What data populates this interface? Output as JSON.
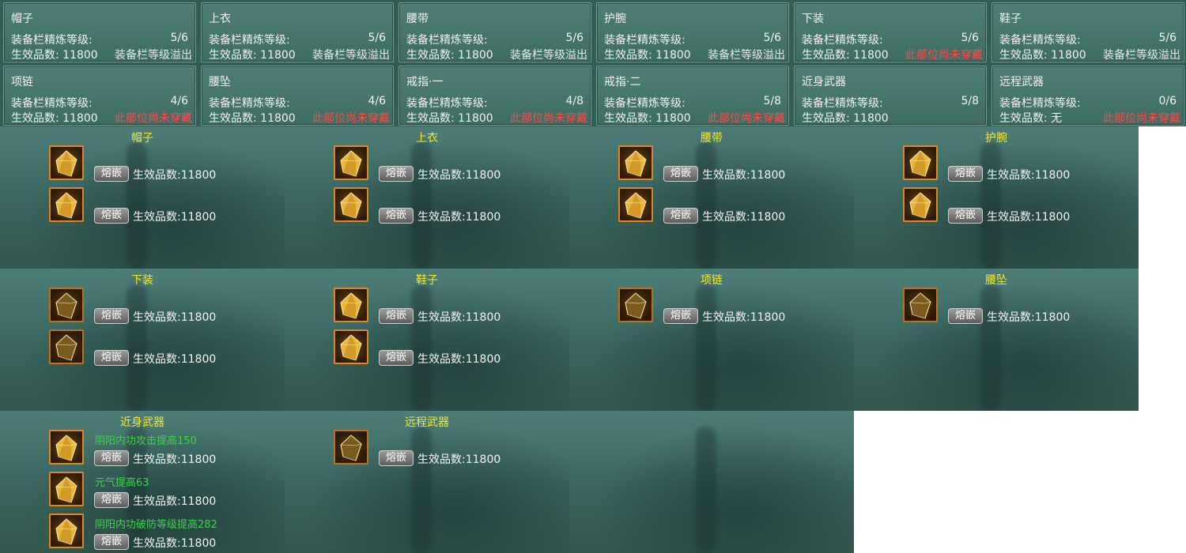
{
  "summary": {
    "level_label": "装备栏精炼等级:",
    "count_label": "生效品数:",
    "cards": [
      {
        "title": "帽子",
        "level": "5/6",
        "count": "11800",
        "note": "装备栏等级溢出",
        "warn": false
      },
      {
        "title": "上衣",
        "level": "5/6",
        "count": "11800",
        "note": "装备栏等级溢出",
        "warn": false
      },
      {
        "title": "腰带",
        "level": "5/6",
        "count": "11800",
        "note": "装备栏等级溢出",
        "warn": false
      },
      {
        "title": "护腕",
        "level": "5/6",
        "count": "11800",
        "note": "装备栏等级溢出",
        "warn": false
      },
      {
        "title": "下装",
        "level": "5/6",
        "count": "11800",
        "note": "此部位尚未穿戴",
        "warn": true
      },
      {
        "title": "鞋子",
        "level": "5/6",
        "count": "11800",
        "note": "装备栏等级溢出",
        "warn": false
      },
      {
        "title": "项链",
        "level": "4/6",
        "count": "11800",
        "note": "此部位尚未穿戴",
        "warn": true
      },
      {
        "title": "腰坠",
        "level": "4/6",
        "count": "11800",
        "note": "此部位尚未穿戴",
        "warn": true
      },
      {
        "title": "戒指·一",
        "level": "4/8",
        "count": "11800",
        "note": "此部位尚未穿戴",
        "warn": true
      },
      {
        "title": "戒指·二",
        "level": "5/8",
        "count": "11800",
        "note": "此部位尚未穿戴",
        "warn": true
      },
      {
        "title": "近身武器",
        "level": "5/8",
        "count": "11800",
        "note": "",
        "warn": false
      },
      {
        "title": "远程武器",
        "level": "0/6",
        "count": "无",
        "note": "此部位尚未穿戴",
        "warn": true
      }
    ]
  },
  "panels": [
    {
      "title": "帽子",
      "slots": [
        {
          "lit": true,
          "btn": "熔嵌",
          "value": "生效品数:11800"
        },
        {
          "lit": true,
          "btn": "熔嵌",
          "value": "生效品数:11800"
        }
      ]
    },
    {
      "title": "上衣",
      "slots": [
        {
          "lit": true,
          "btn": "熔嵌",
          "value": "生效品数:11800"
        },
        {
          "lit": true,
          "btn": "熔嵌",
          "value": "生效品数:11800"
        }
      ]
    },
    {
      "title": "腰带",
      "slots": [
        {
          "lit": true,
          "btn": "熔嵌",
          "value": "生效品数:11800"
        },
        {
          "lit": true,
          "btn": "熔嵌",
          "value": "生效品数:11800"
        }
      ]
    },
    {
      "title": "护腕",
      "slots": [
        {
          "lit": true,
          "btn": "熔嵌",
          "value": "生效品数:11800"
        },
        {
          "lit": true,
          "btn": "熔嵌",
          "value": "生效品数:11800"
        }
      ]
    },
    {
      "title": "下装",
      "slots": [
        {
          "lit": false,
          "btn": "熔嵌",
          "value": "生效品数:11800"
        },
        {
          "lit": false,
          "btn": "熔嵌",
          "value": "生效品数:11800"
        }
      ]
    },
    {
      "title": "鞋子",
      "slots": [
        {
          "lit": true,
          "btn": "熔嵌",
          "value": "生效品数:11800"
        },
        {
          "lit": true,
          "btn": "熔嵌",
          "value": "生效品数:11800"
        }
      ]
    },
    {
      "title": "项链",
      "slots": [
        {
          "lit": false,
          "btn": "熔嵌",
          "value": "生效品数:11800"
        }
      ]
    },
    {
      "title": "腰坠",
      "slots": [
        {
          "lit": false,
          "btn": "熔嵌",
          "value": "生效品数:11800"
        }
      ]
    },
    {
      "title": "近身武器",
      "slots": [
        {
          "lit": true,
          "effect": "阴阳内功攻击提高150",
          "btn": "熔嵌",
          "value": "生效品数:11800"
        },
        {
          "lit": true,
          "effect": "元气提高63",
          "btn": "熔嵌",
          "value": "生效品数:11800"
        },
        {
          "lit": true,
          "effect": "阴阳内功破防等级提高282",
          "btn": "熔嵌",
          "value": "生效品数:11800"
        }
      ]
    },
    {
      "title": "远程武器",
      "slots": [
        {
          "lit": false,
          "btn": "熔嵌",
          "value": "生效品数:11800"
        }
      ]
    }
  ]
}
